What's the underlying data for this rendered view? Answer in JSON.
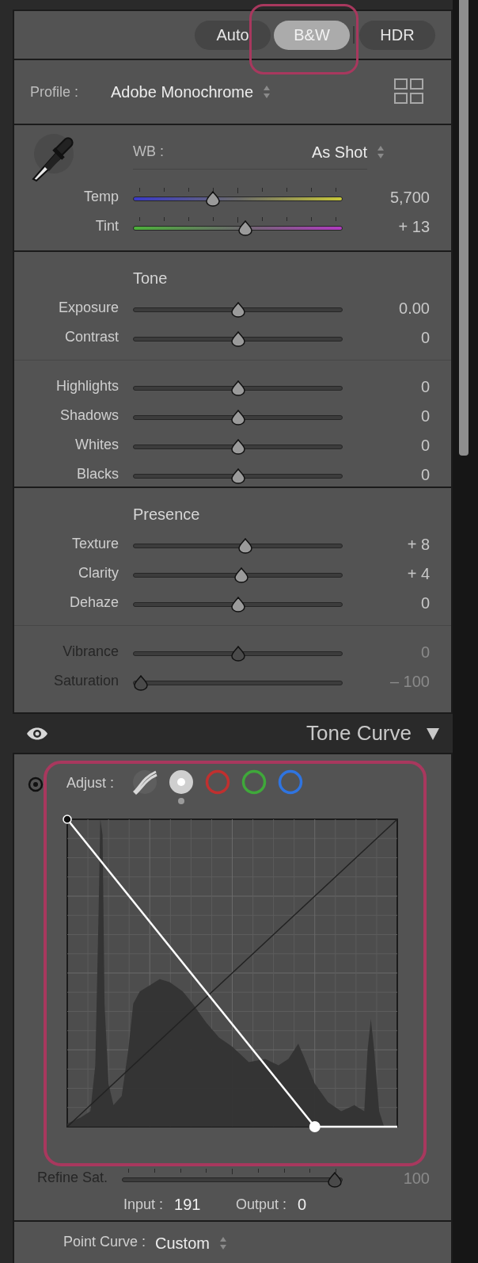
{
  "presets": [
    {
      "label": "Auto",
      "selected": false
    },
    {
      "label": "B&W",
      "selected": true
    },
    {
      "label": "HDR",
      "selected": false
    }
  ],
  "profile": {
    "label": "Profile :",
    "value": "Adobe Monochrome"
  },
  "white_balance": {
    "label": "WB :",
    "value": "As Shot",
    "sliders": [
      {
        "label": "Temp",
        "kind": "temp",
        "level": 0.37,
        "value": "5,700",
        "disabled": false
      },
      {
        "label": "Tint",
        "kind": "tint",
        "level": 0.54,
        "value": "+ 13",
        "disabled": false
      }
    ]
  },
  "tone": {
    "title": "Tone",
    "groups": [
      {
        "sliders": [
          {
            "label": "Exposure",
            "kind": "plain",
            "level": 0.5,
            "value": "0.00",
            "disabled": false
          },
          {
            "label": "Contrast",
            "kind": "plain",
            "level": 0.5,
            "value": "0",
            "disabled": false
          }
        ]
      },
      {
        "sliders": [
          {
            "label": "Highlights",
            "kind": "plain",
            "level": 0.5,
            "value": "0",
            "disabled": false
          },
          {
            "label": "Shadows",
            "kind": "plain",
            "level": 0.5,
            "value": "0",
            "disabled": false
          },
          {
            "label": "Whites",
            "kind": "plain",
            "level": 0.5,
            "value": "0",
            "disabled": false
          },
          {
            "label": "Blacks",
            "kind": "plain",
            "level": 0.5,
            "value": "0",
            "disabled": false
          }
        ]
      }
    ]
  },
  "presence": {
    "title": "Presence",
    "groups": [
      {
        "sliders": [
          {
            "label": "Texture",
            "kind": "plain",
            "level": 0.54,
            "value": "+ 8",
            "disabled": false
          },
          {
            "label": "Clarity",
            "kind": "plain",
            "level": 0.52,
            "value": "+ 4",
            "disabled": false
          },
          {
            "label": "Dehaze",
            "kind": "plain",
            "level": 0.5,
            "value": "0",
            "disabled": false
          }
        ]
      },
      {
        "sliders": [
          {
            "label": "Vibrance",
            "kind": "plain",
            "level": 0.5,
            "value": "0",
            "disabled": true
          },
          {
            "label": "Saturation",
            "kind": "plain",
            "level": 0,
            "value": "– 100",
            "disabled": true
          }
        ]
      }
    ]
  },
  "tone_curve": {
    "title": "Tone Curve",
    "adjust_label": "Adjust :",
    "channels": [
      {
        "kind": "parametric",
        "selected": false
      },
      {
        "kind": "point",
        "selected": true
      },
      {
        "kind": "ring",
        "color": "#c0302f",
        "selected": false
      },
      {
        "kind": "ring",
        "color": "#3fa83a",
        "selected": false
      },
      {
        "kind": "ring",
        "color": "#2f74e0",
        "selected": false
      }
    ],
    "refine": {
      "label": "Refine Sat.",
      "kind": "ticked",
      "level": 1,
      "value": "100",
      "disabled": true
    },
    "input_label": "Input :",
    "input_value": "191",
    "output_label": "Output :",
    "output_value": "0",
    "point_curve": {
      "label": "Point Curve :",
      "value": "Custom"
    }
  }
}
